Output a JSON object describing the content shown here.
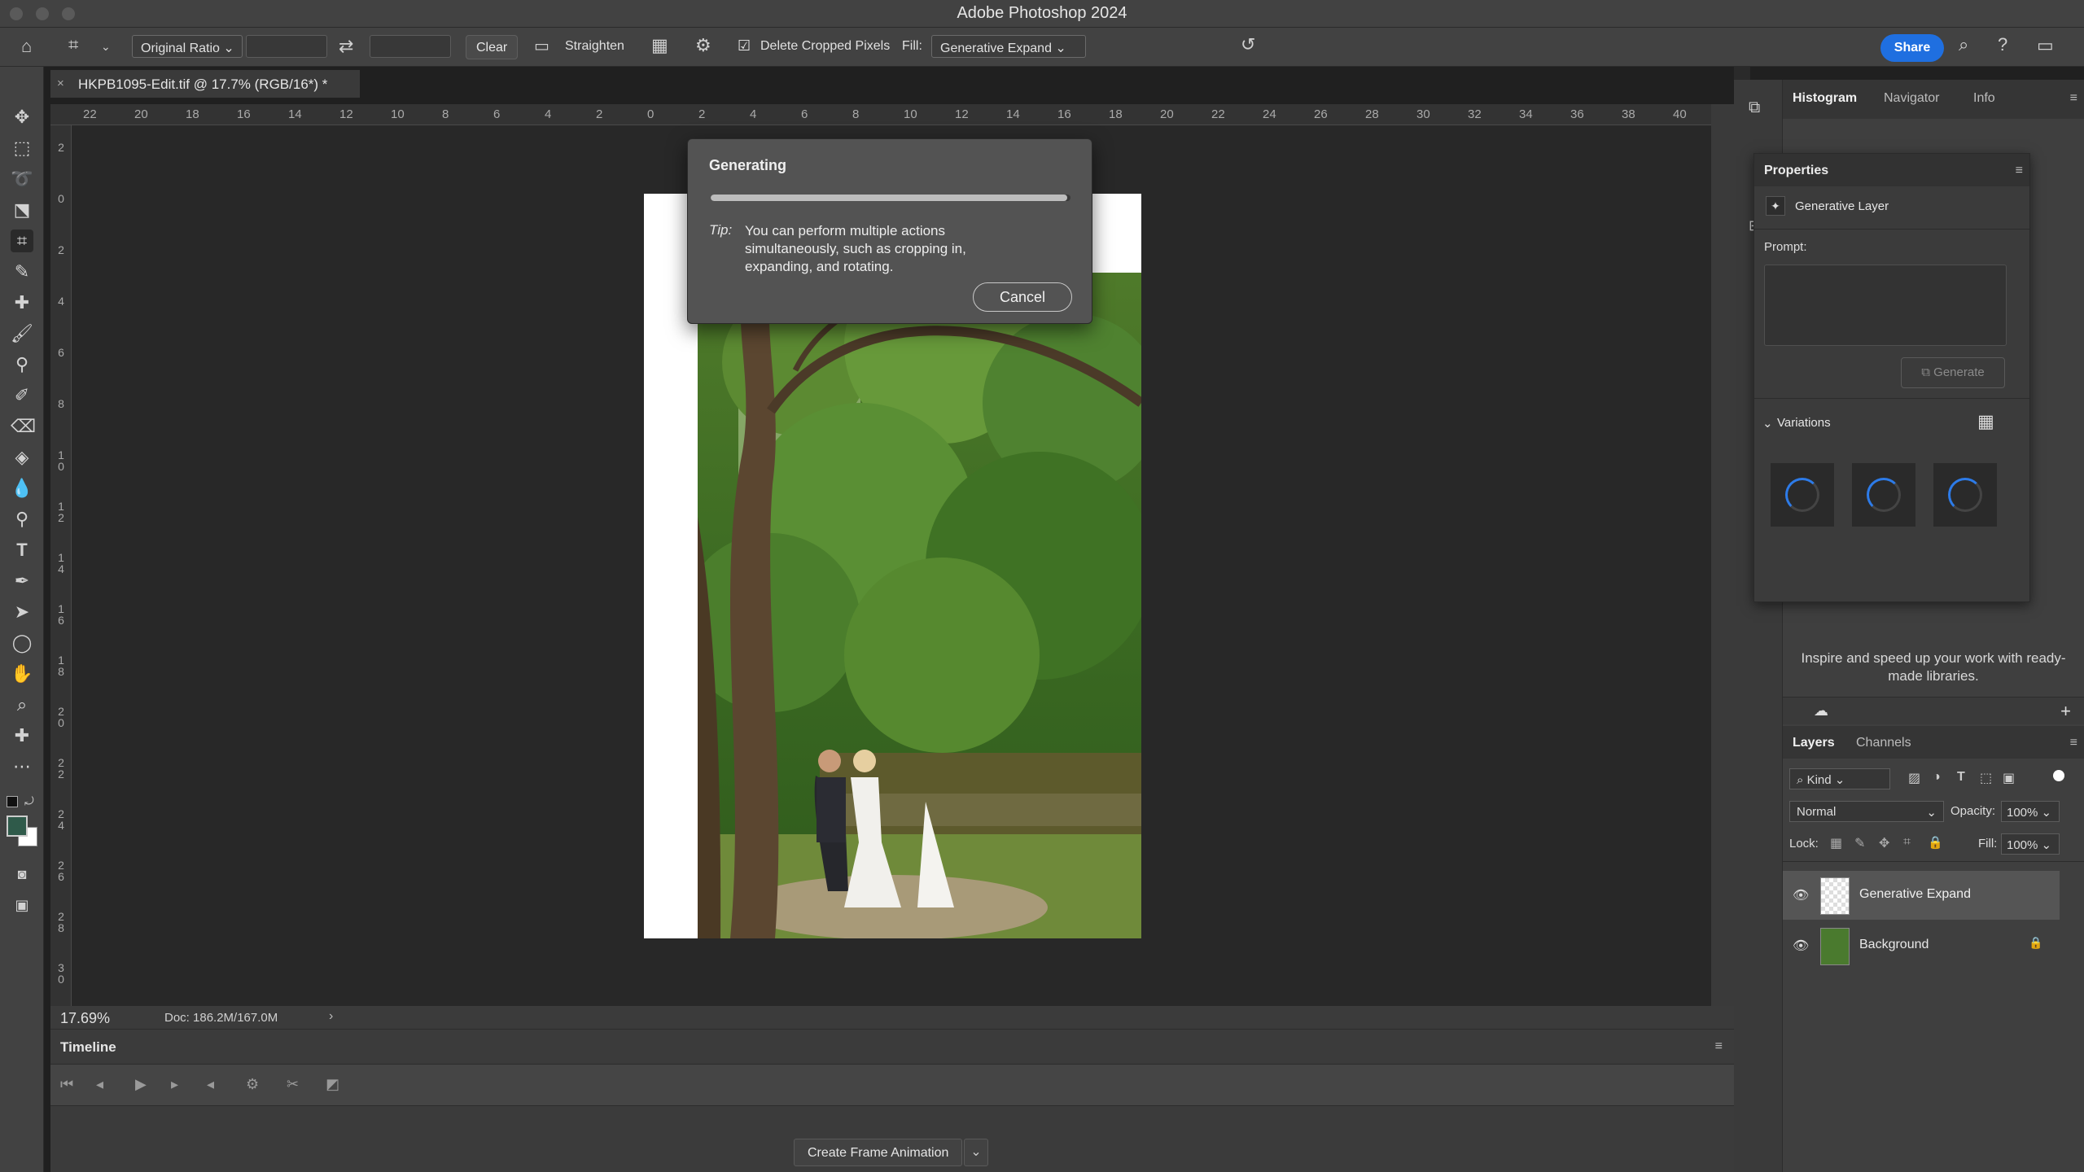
{
  "app": {
    "title": "Adobe Photoshop 2024"
  },
  "options": {
    "ratio": "Original Ratio",
    "clear": "Clear",
    "straighten": "Straighten",
    "delete_cropped": "Delete Cropped Pixels",
    "fill_label": "Fill:",
    "fill_value": "Generative Expand",
    "share": "Share"
  },
  "document": {
    "tab_label": "HKPB1095-Edit.tif @ 17.7% (RGB/16*) *",
    "zoom": "17.69%",
    "doc_size": "Doc: 186.2M/167.0M"
  },
  "ruler": {
    "top_ticks": [
      "22",
      "20",
      "18",
      "16",
      "14",
      "12",
      "10",
      "8",
      "6",
      "4",
      "2",
      "0",
      "2",
      "4",
      "6",
      "8",
      "10",
      "12",
      "14",
      "16",
      "18",
      "20",
      "22",
      "24",
      "26",
      "28",
      "30",
      "32",
      "34",
      "36",
      "38",
      "40"
    ],
    "left_ticks": [
      "2",
      "0",
      "2",
      "4",
      "6",
      "8",
      "1 0",
      "1 2",
      "1 4",
      "1 6",
      "1 8",
      "2 0",
      "2 2",
      "2 4",
      "2 6",
      "2 8",
      "3 0"
    ]
  },
  "dialog": {
    "title": "Generating",
    "progress": 0.99,
    "tip_label": "Tip:",
    "tip_text": "You can perform multiple actions simultaneously, such as cropping in, expanding, and rotating.",
    "cancel": "Cancel"
  },
  "timeline": {
    "title": "Timeline",
    "create_frame": "Create Frame Animation"
  },
  "top_panel": {
    "tabs": [
      "Histogram",
      "Navigator",
      "Info"
    ]
  },
  "properties": {
    "title": "Properties",
    "layer_type": "Generative Layer",
    "prompt_label": "Prompt:",
    "generate": "Generate",
    "variations": "Variations"
  },
  "libraries": {
    "text": "Inspire and speed up your work with ready-made libraries."
  },
  "layers": {
    "tabs": [
      "Layers",
      "Channels"
    ],
    "kind": "Kind",
    "blend": "Normal",
    "opacity_label": "Opacity:",
    "opacity": "100%",
    "lock_label": "Lock:",
    "fill_label": "Fill:",
    "fill": "100%",
    "items": [
      {
        "name": "Generative Expand"
      },
      {
        "name": "Background"
      }
    ]
  }
}
